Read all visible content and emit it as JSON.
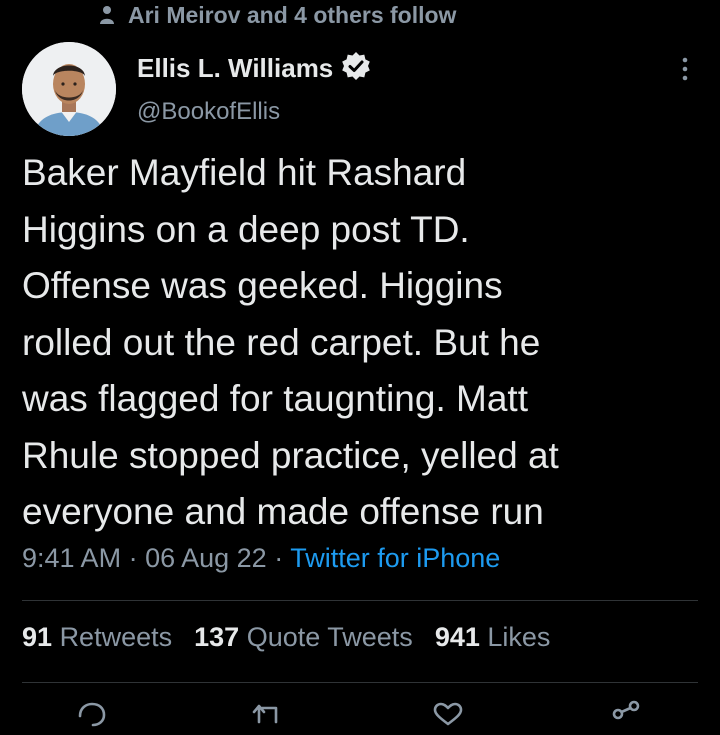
{
  "social_context": {
    "text": "Ari Meirov and 4 others follow",
    "icon": "person-icon"
  },
  "author": {
    "name": "Ellis L. Williams",
    "handle": "@BookofEllis",
    "verified": true,
    "verified_color": "#e7e9ea"
  },
  "tweet": {
    "text": "Baker Mayfield hit Rashard\nHiggins on a deep post TD.\nOffense was geeked. Higgins\nrolled out the red carpet. But he\nwas flagged for taugnting. Matt\nRhule stopped practice, yelled at\neveryone and made offense run"
  },
  "meta": {
    "time": "9:41 AM",
    "separator": " · ",
    "date": "06 Aug 22",
    "source": "Twitter for iPhone"
  },
  "stats": {
    "retweets_count": "91",
    "retweets_label": "Retweets",
    "quotes_count": "137",
    "quotes_label": "Quote Tweets",
    "likes_count": "941",
    "likes_label": "Likes"
  },
  "actions": [
    "reply-icon",
    "retweet-icon",
    "like-icon",
    "share-icon"
  ],
  "colors": {
    "background": "#000000",
    "text": "#e7e9ea",
    "secondary": "#8b98a5",
    "link": "#1d9bf0",
    "divider": "#2f3336"
  }
}
